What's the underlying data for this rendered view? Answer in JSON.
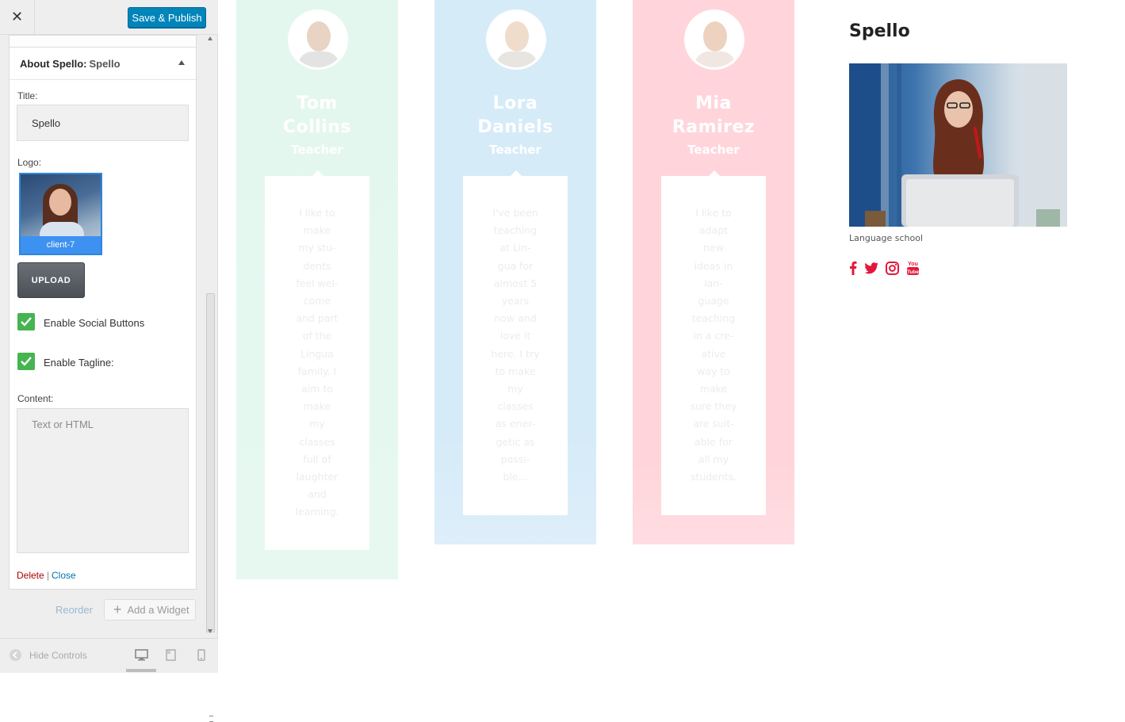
{
  "topbar": {
    "close_glyph": "✕",
    "publish_label": "Save & Publish"
  },
  "widget": {
    "header_title": "About Spello:",
    "header_sub": "Spello",
    "title_label": "Title:",
    "title_value": "Spello",
    "logo_label": "Logo:",
    "logo_caption": "client-7",
    "upload_label": "UPLOAD",
    "social_label": "Enable Social Buttons",
    "social_checked": true,
    "tagline_label": "Enable Tagline:",
    "tagline_checked": true,
    "content_label": "Content:",
    "content_placeholder": "Text or HTML",
    "delete_label": "Delete",
    "separator": "|",
    "close_label": "Close"
  },
  "sidebar_footer": {
    "reorder_label": "Reorder",
    "add_widget_label": "Add a Widget",
    "hide_controls_label": "Hide Controls"
  },
  "icons": [
    "close-icon",
    "collapse-up-icon",
    "checkmark-icon",
    "plus-icon",
    "collapse-sidebar-icon",
    "desktop-icon",
    "tablet-icon",
    "mobile-icon",
    "facebook-icon",
    "twitter-icon",
    "instagram-icon",
    "youtube-icon"
  ],
  "colors": {
    "publish": "#0085ba",
    "checkbox": "#46b450",
    "card1": "#e3f7ef",
    "card2": "#d6ebf8",
    "card3": "#ffd5db",
    "social": "#e4173a"
  },
  "teachers": [
    {
      "name_line1": "Tom",
      "name_line2": "Collins",
      "role": "Teacher",
      "bio": [
        "I like to",
        "make",
        "my stu-",
        "dents",
        "feel wel-",
        "come",
        "and part",
        "of the",
        "Lingua",
        "family. I",
        "aim to",
        "make",
        "my",
        "classes",
        "full of",
        "laughter",
        "and",
        "learning."
      ]
    },
    {
      "name_line1": "Lora",
      "name_line2": "Daniels",
      "role": "Teacher",
      "bio": [
        "I've been",
        "teaching",
        "at Lin-",
        "gua for",
        "almost 5",
        "years",
        "now and",
        "love it",
        "here. I try",
        "to make",
        "my",
        "classes",
        "as ener-",
        "getic as",
        "possi-",
        "ble..."
      ]
    },
    {
      "name_line1": "Mia",
      "name_line2": "Ramirez",
      "role": "Teacher",
      "bio": [
        "I like to",
        "adapt",
        "new",
        "ideas in",
        "lan-",
        "guage",
        "teaching",
        "in a cre-",
        "ative",
        "way to",
        "make",
        "sure they",
        "are suit-",
        "able for",
        "all my",
        "students."
      ]
    }
  ],
  "about_widget": {
    "title": "Spello",
    "tagline": "Language school",
    "youtube_text_top": "You",
    "youtube_text_bottom": "Tube"
  }
}
